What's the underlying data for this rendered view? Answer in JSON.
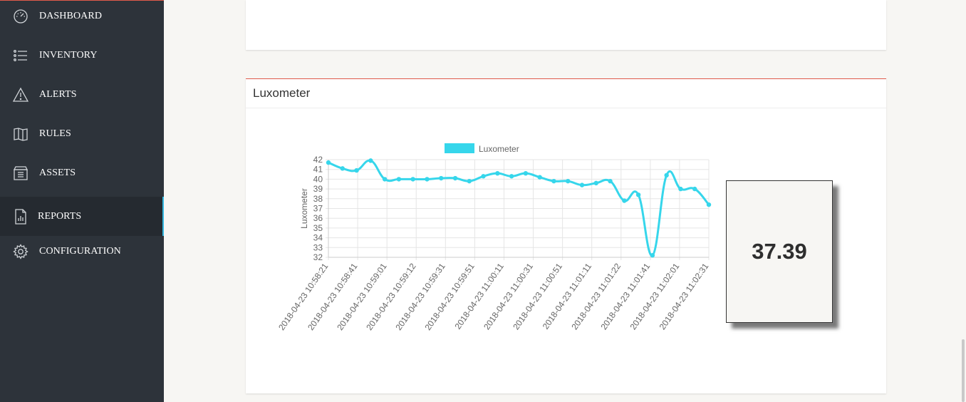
{
  "sidebar": {
    "items": [
      {
        "label": "DASHBOARD",
        "icon": "speedometer-icon",
        "active": false
      },
      {
        "label": "INVENTORY",
        "icon": "list-icon",
        "active": false
      },
      {
        "label": "ALERTS",
        "icon": "warning-icon",
        "active": false
      },
      {
        "label": "RULES",
        "icon": "book-icon",
        "active": false
      },
      {
        "label": "ASSETS",
        "icon": "box-icon",
        "active": false
      },
      {
        "label": "REPORTS",
        "icon": "report-icon",
        "active": true
      },
      {
        "label": "CONFIGURATION",
        "icon": "gear-icon",
        "active": false
      }
    ]
  },
  "colors": {
    "sidebar_bg": "#2d333a",
    "active_bg": "#252a30",
    "accent_blue": "#35b8e0",
    "accent_red": "#e05a4b",
    "series": "#36d6eb"
  },
  "luxometer_card": {
    "title": "Luxometer",
    "current_value": "37.39"
  },
  "chart_data": {
    "type": "line",
    "legend": {
      "label": "Luxometer",
      "position": "top"
    },
    "ylabel": "Luxometer",
    "ylim": [
      32,
      42
    ],
    "yticks": [
      32,
      33,
      34,
      35,
      36,
      37,
      38,
      39,
      40,
      41,
      42
    ],
    "grid": true,
    "xtick_labels": [
      "2018-04-23 10:58:21",
      "2018-04-23 10:58:41",
      "2018-04-23 10:59:01",
      "2018-04-23 10:59:12",
      "2018-04-23 10:59:31",
      "2018-04-23 10:59:51",
      "2018-04-23 11:00:11",
      "2018-04-23 11:00:31",
      "2018-04-23 11:00:51",
      "2018-04-23 11:01:11",
      "2018-04-23 11:01:22",
      "2018-04-23 11:01:41",
      "2018-04-23 11:02:01",
      "2018-04-23 11:02:31"
    ],
    "series": [
      {
        "name": "Luxometer",
        "values": [
          41.7,
          41.1,
          40.9,
          41.9,
          40.0,
          40.0,
          40.0,
          40.0,
          40.1,
          40.1,
          39.8,
          40.3,
          40.6,
          40.3,
          40.6,
          40.2,
          39.8,
          39.8,
          39.4,
          39.6,
          39.8,
          37.8,
          38.4,
          32.2,
          40.4,
          39.0,
          39.0,
          37.39
        ]
      }
    ]
  }
}
